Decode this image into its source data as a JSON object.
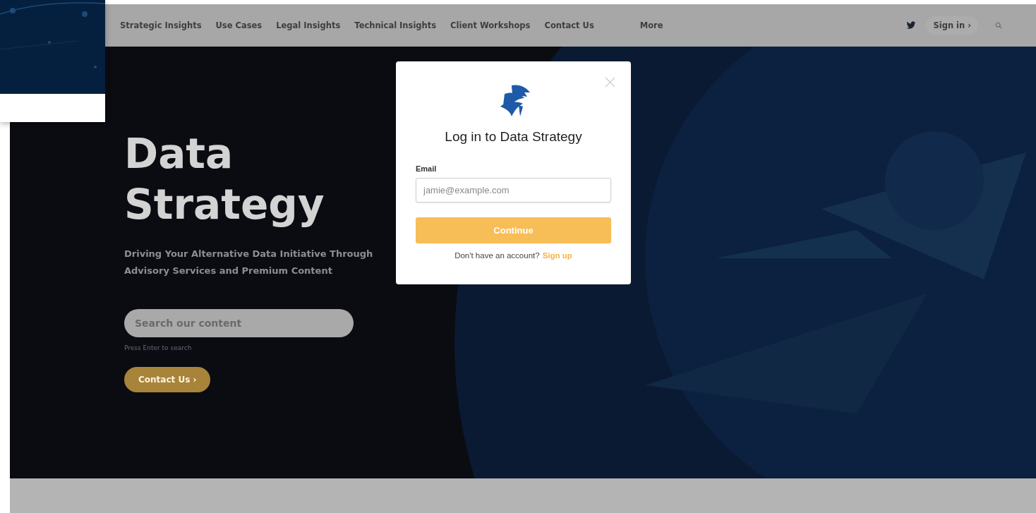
{
  "nav": {
    "items": [
      "Strategic Insights",
      "Use Cases",
      "Legal Insights",
      "Technical Insights",
      "Client Workshops",
      "Contact Us"
    ],
    "more": "More",
    "sign_in": "Sign in ›"
  },
  "hero": {
    "title": "Data Strategy",
    "subtitle": "Driving Your Alternative Data Initiative Through Advisory Services and Premium Content",
    "search": {
      "placeholder": "Search our content"
    },
    "search_hint": "Press Enter to search",
    "button": "Contact Us ›"
  },
  "modal": {
    "title": "Log in to Data Strategy",
    "email_label": "Email",
    "email": {
      "placeholder": "jamie@example.com"
    },
    "continue": "Continue",
    "signup_prompt": "Don't have an account?",
    "signup_link": "Sign up"
  }
}
